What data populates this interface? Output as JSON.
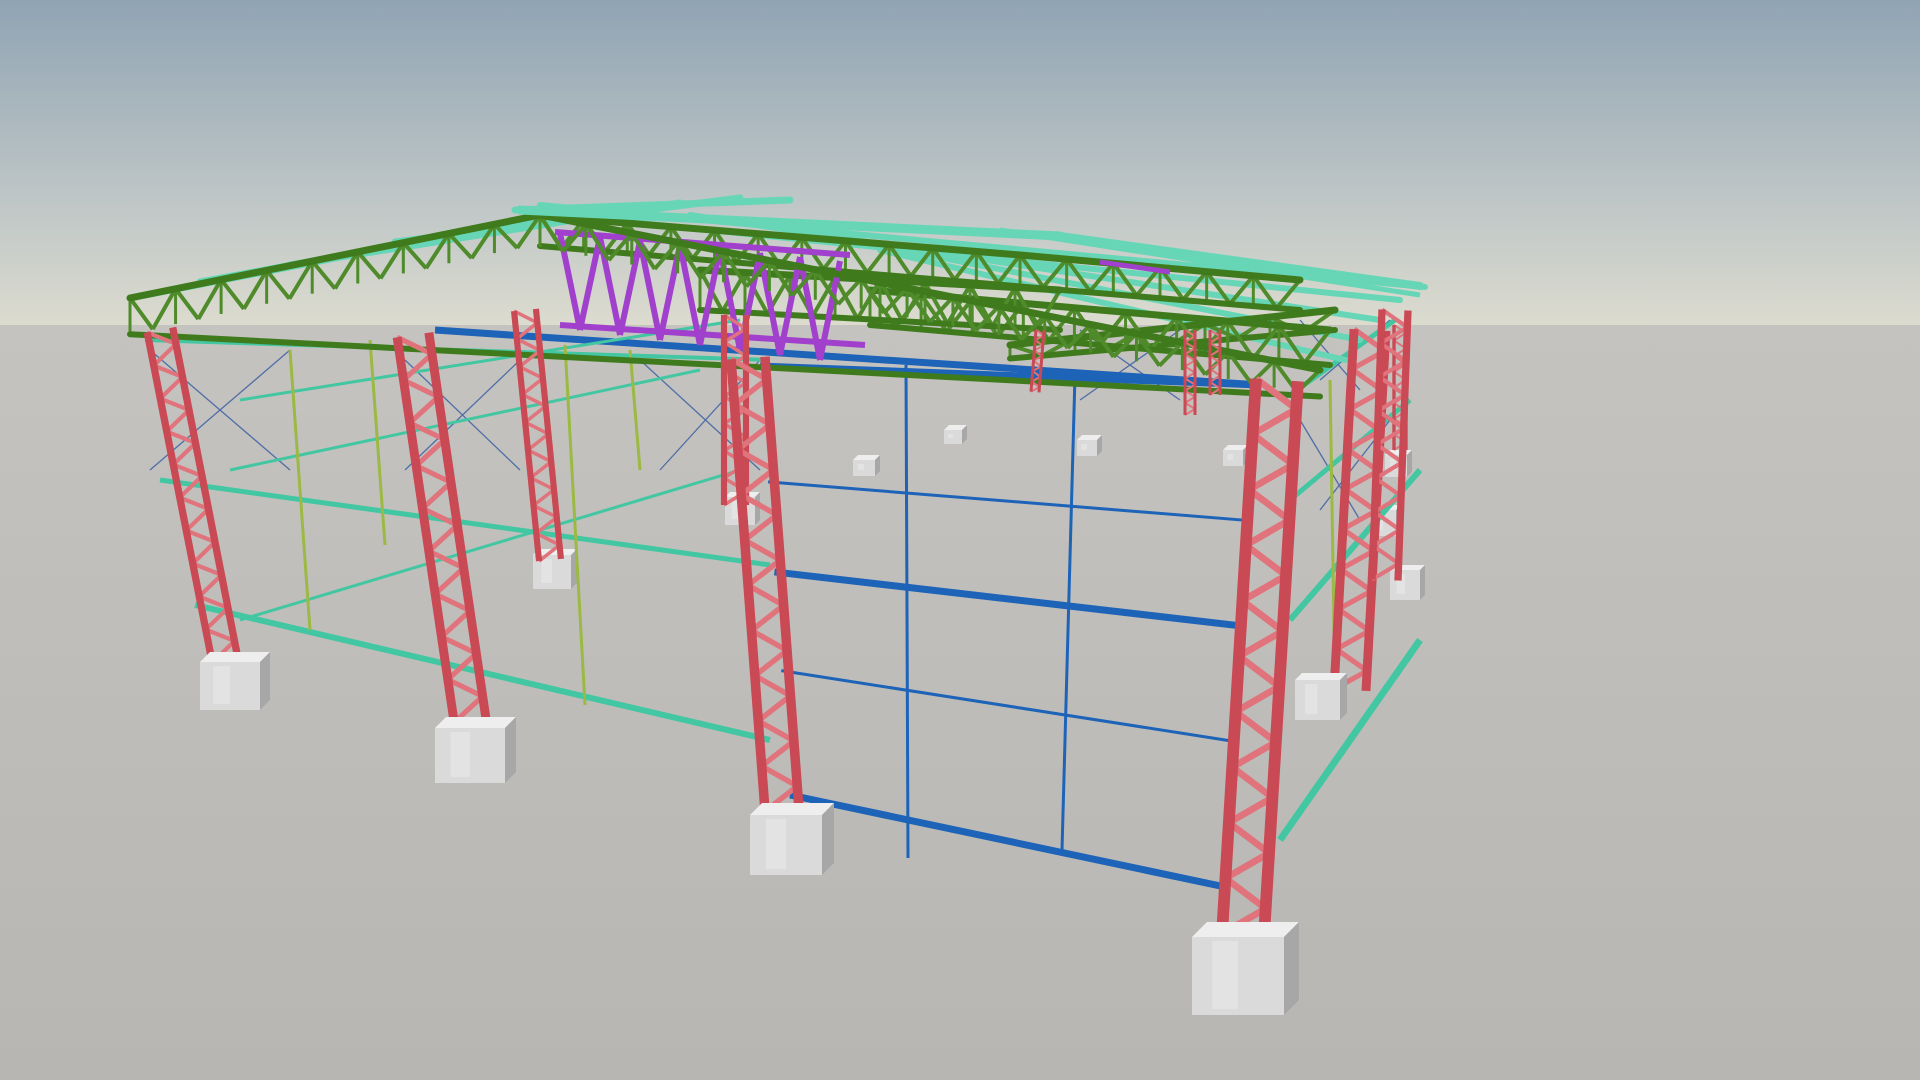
{
  "viewport": {
    "scene": "structural-steel-frame-3d-view",
    "colors": {
      "sky_top": "#90a4b4",
      "sky_mid": "#c4cac8",
      "horizon": "#dddccf",
      "ground": "#b8b6b2",
      "columns": "#c94954",
      "column_lacing": "#e0737b",
      "truss": "#4f8b2a",
      "truss_chord": "#3f7b1d",
      "bracing_truss": "#a040cc",
      "roof_purlins": "#66d6b7",
      "wall_girts": "#42c7a2",
      "end_wall": "#1d63b8",
      "wind_posts": "#9bb943",
      "cross_bracing": "#4e6ea8",
      "footings": "#dadada",
      "footing_shadow": "#a7a7a7"
    }
  }
}
